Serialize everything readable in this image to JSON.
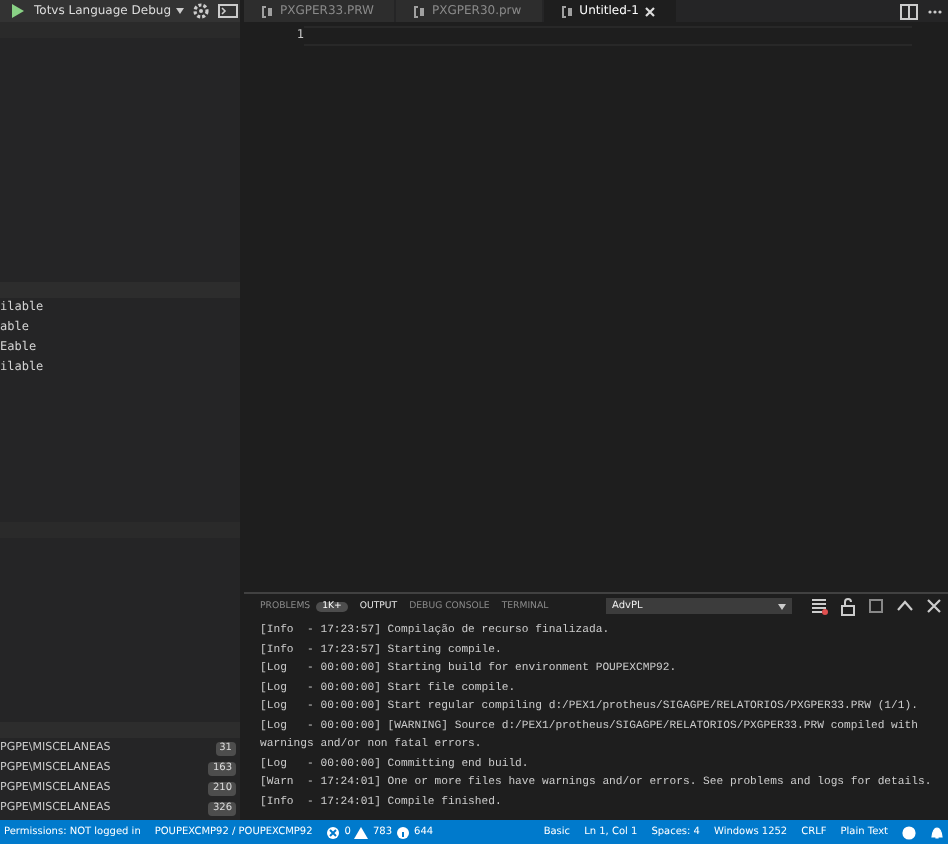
{
  "debug_toolbar": {
    "configuration": "Totvs Language Debug"
  },
  "editor_tabs": [
    {
      "label": "PXGPER33.PRW",
      "selected": false
    },
    {
      "label": "PXGPER30.prw",
      "selected": false
    },
    {
      "label": "Untitled-1",
      "selected": true
    }
  ],
  "editor": {
    "line_numbers": [
      "1"
    ]
  },
  "sidebar": {
    "sections": [
      {
        "kind": "empty"
      },
      {
        "kind": "variables",
        "items": [
          "ilable",
          "able",
          "Eable",
          "ilable"
        ]
      },
      {
        "kind": "empty"
      },
      {
        "kind": "folders",
        "items": [
          {
            "label": "PGPE\\MISCELANEAS",
            "count": "31"
          },
          {
            "label": "PGPE\\MISCELANEAS",
            "count": "163"
          },
          {
            "label": "PGPE\\MISCELANEAS",
            "count": "210"
          },
          {
            "label": "PGPE\\MISCELANEAS",
            "count": "326"
          }
        ]
      }
    ]
  },
  "panel": {
    "tabs": [
      {
        "label": "PROBLEMS",
        "badge": "1K+",
        "selected": false
      },
      {
        "label": "OUTPUT",
        "selected": true
      },
      {
        "label": "DEBUG CONSOLE",
        "selected": false
      },
      {
        "label": "TERMINAL",
        "selected": false
      }
    ],
    "channel": "AdvPL",
    "output_lines": [
      "[Info  - 17:23:57] Compilação de recurso finalizada.",
      "[Info  - 17:23:57] Starting compile.",
      "[Log   - 00:00:00] Starting build for environment POUPEXCMP92.",
      "[Log   - 00:00:00] Start file compile.",
      "[Log   - 00:00:00] Start regular compiling d:/PEX1/protheus/SIGAGPE/RELATORIOS/PXGPER33.PRW (1/1).",
      "[Log   - 00:00:00] [WARNING] Source d:/PEX1/protheus/SIGAGPE/RELATORIOS/PXGPER33.PRW compiled with warnings and/or non fatal errors.",
      "[Log   - 00:00:00] Committing end build.",
      "[Warn  - 17:24:01] One or more files have warnings and/or errors. See problems and logs for details.",
      "[Info  - 17:24:01] Compile finished."
    ]
  },
  "status_bar": {
    "left": [
      "Permissions: NOT logged in",
      "POUPEXCMP92 / POUPEXCMP92"
    ],
    "errors": "0",
    "warnings": "783",
    "infos": "644",
    "right": [
      "Basic",
      "Ln 1, Col 1",
      "Spaces: 4",
      "Windows 1252",
      "CRLF",
      "Plain Text"
    ]
  }
}
